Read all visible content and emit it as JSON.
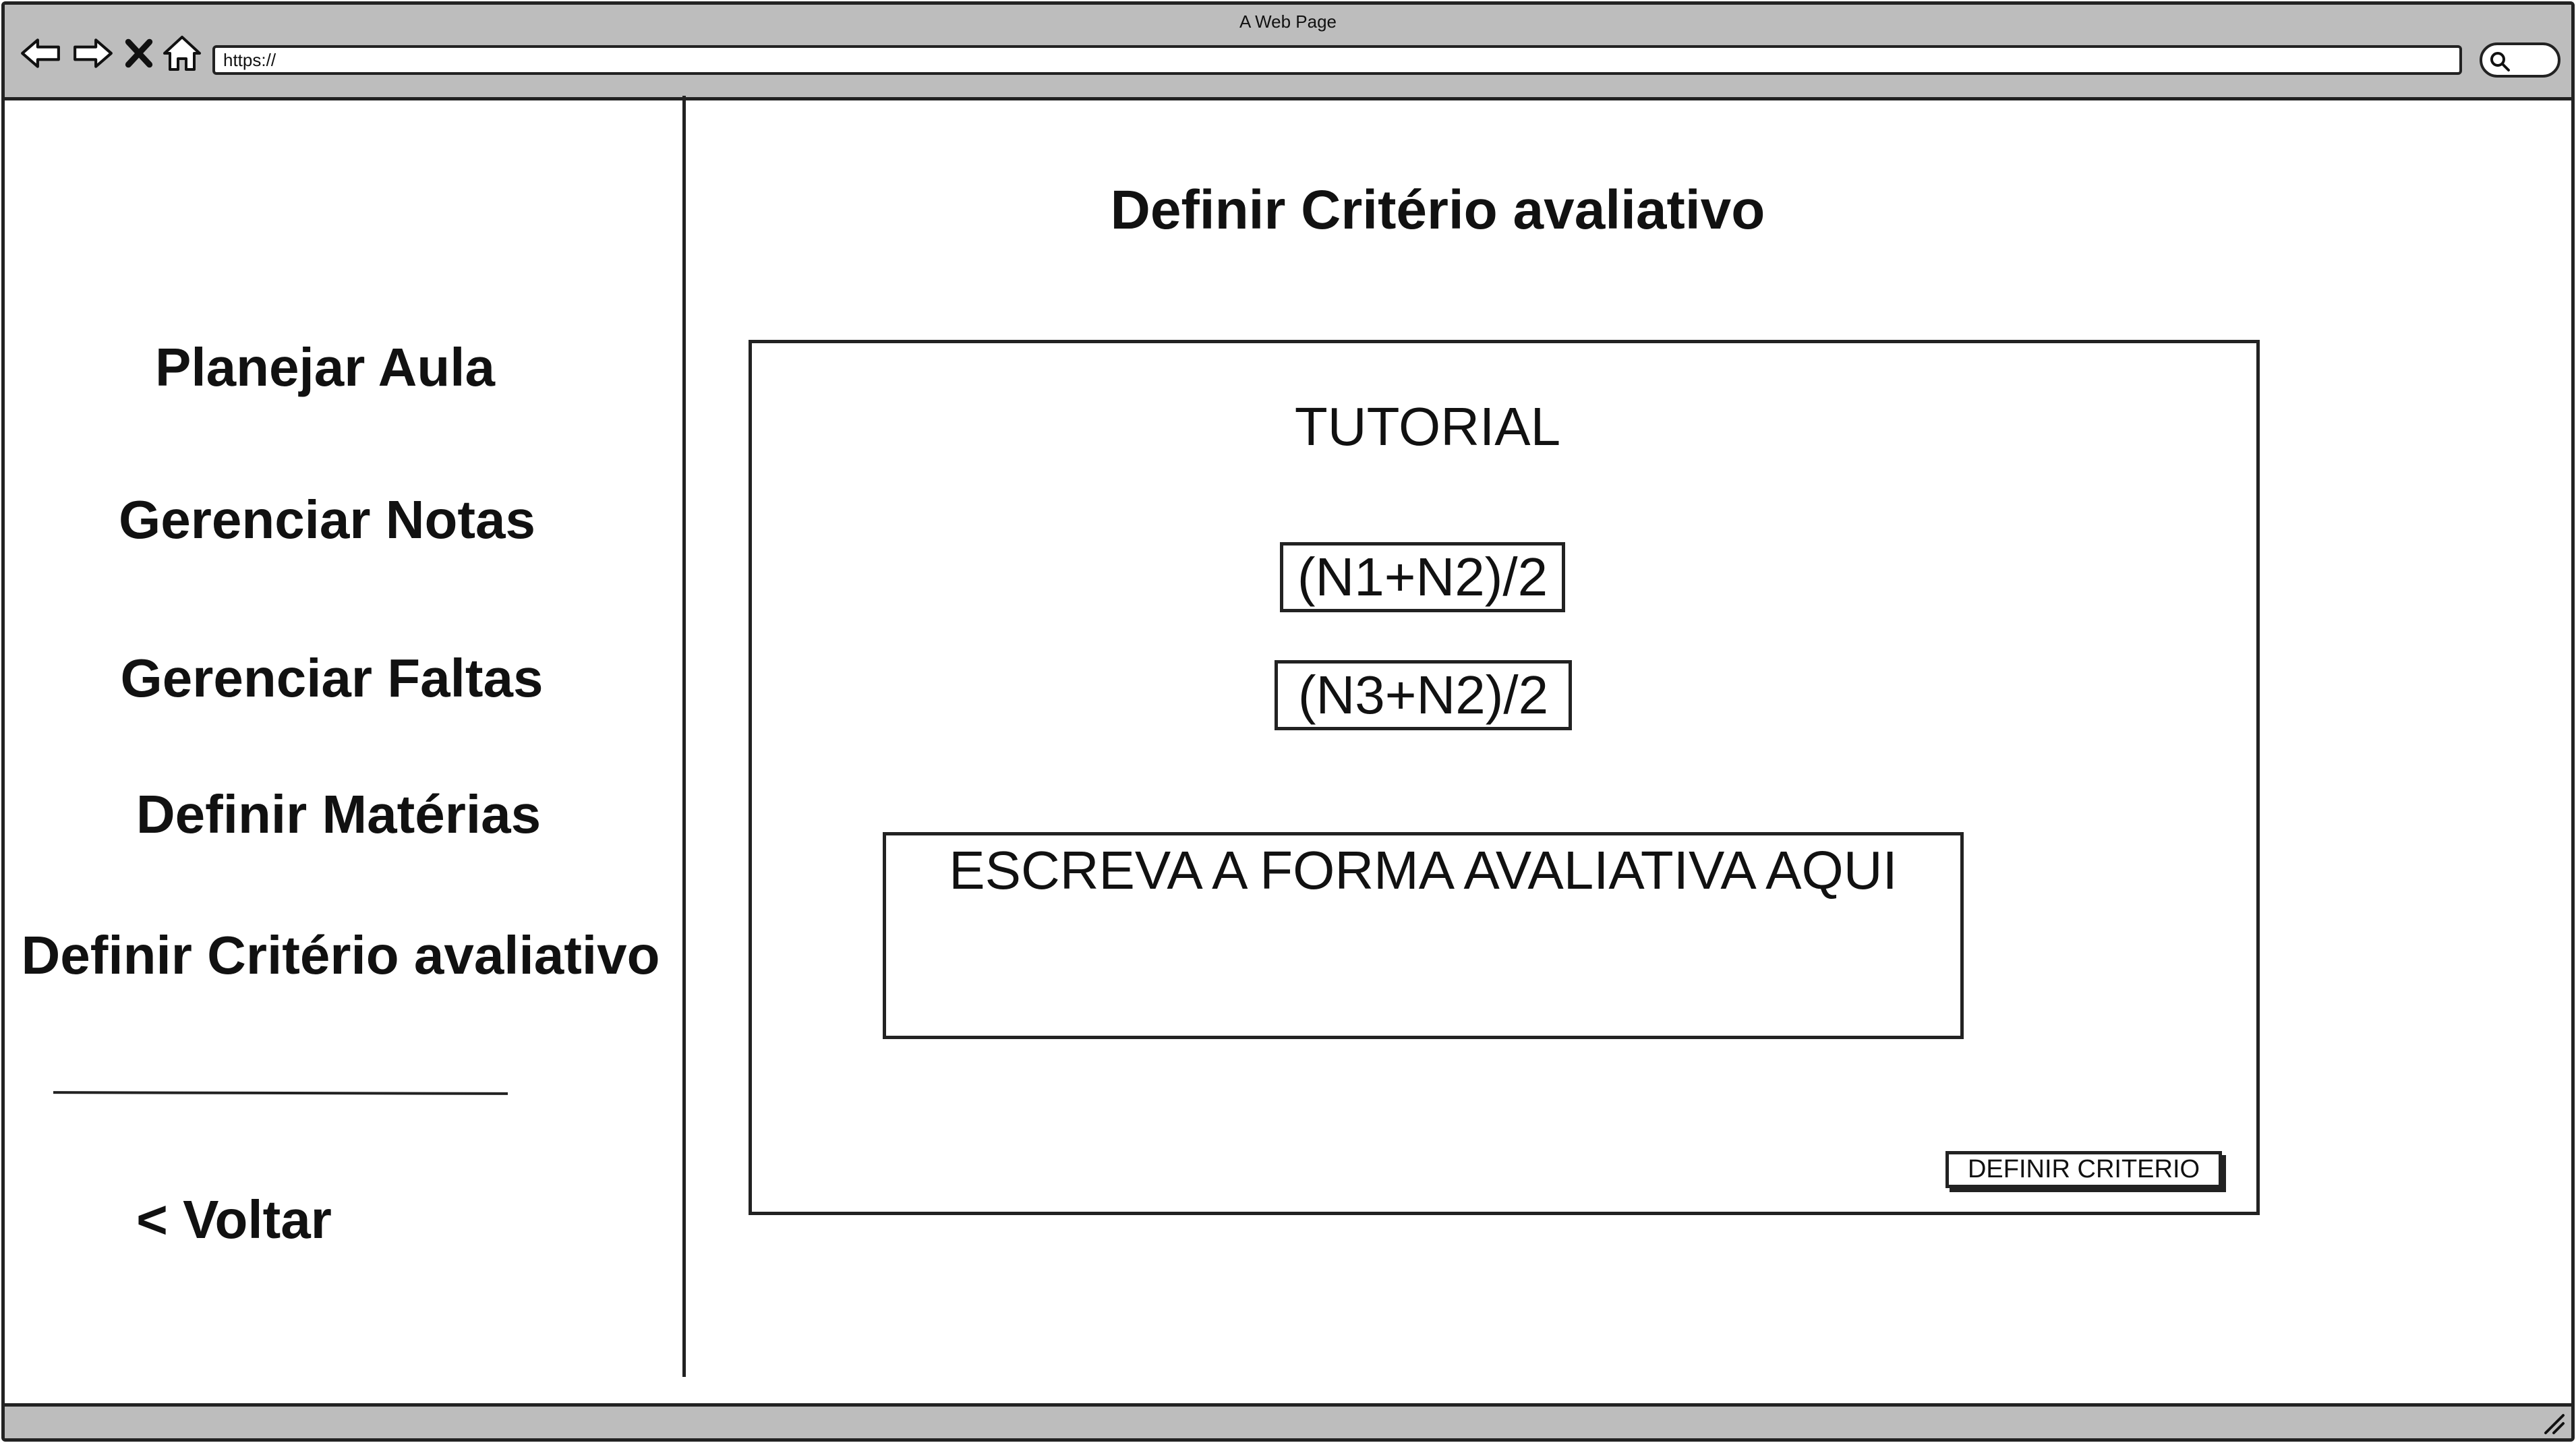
{
  "browser": {
    "window_title": "A Web Page",
    "url": "https://",
    "icons": [
      "back-arrow-icon",
      "forward-arrow-icon",
      "close-icon",
      "home-icon",
      "search-icon",
      "resize-grip-icon"
    ]
  },
  "sidebar": {
    "items": [
      {
        "label": "Planejar Aula"
      },
      {
        "label": "Gerenciar Notas"
      },
      {
        "label": "Gerenciar Faltas"
      },
      {
        "label": "Definir Matérias"
      },
      {
        "label": "Definir Critério avaliativo"
      }
    ],
    "back_label": "< Voltar"
  },
  "main": {
    "title": "Definir Critério avaliativo",
    "tutorial_label": "TUTORIAL",
    "formulas": [
      "(N1+N2)/2",
      "(N3+N2)/2"
    ],
    "criteria_input_placeholder": "ESCREVA A FORMA AVALIATIVA AQUI",
    "define_button_label": "DEFINIR CRITERIO"
  }
}
